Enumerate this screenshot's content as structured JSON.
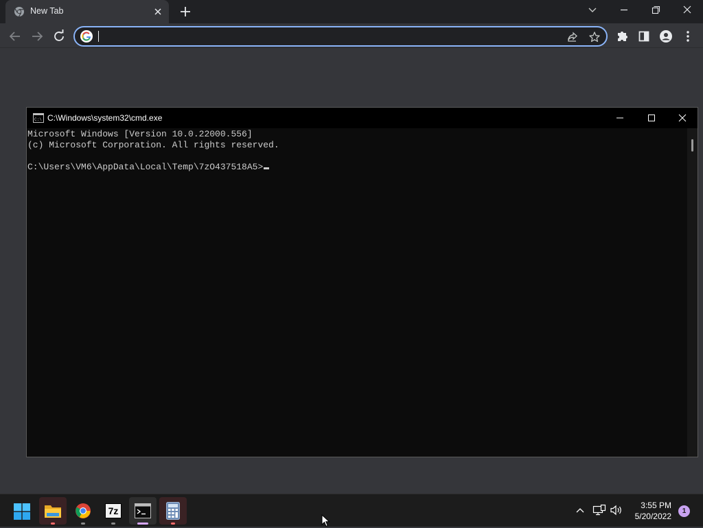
{
  "browser": {
    "tab": {
      "title": "New Tab"
    },
    "omnibox": {
      "value": "",
      "placeholder": ""
    }
  },
  "cmd": {
    "title": "C:\\Windows\\system32\\cmd.exe",
    "lines": [
      "Microsoft Windows [Version 10.0.22000.556]",
      "(c) Microsoft Corporation. All rights reserved.",
      "",
      "C:\\Users\\VM6\\AppData\\Local\\Temp\\7zO437518A5>"
    ]
  },
  "taskbar": {
    "apps": [
      {
        "icon": "windows-start-icon"
      },
      {
        "icon": "file-explorer-icon"
      },
      {
        "icon": "chrome-icon"
      },
      {
        "icon": "7zip-icon",
        "label": "7z"
      },
      {
        "icon": "cmd-icon"
      },
      {
        "icon": "calculator-icon"
      }
    ],
    "clock": {
      "time": "3:55 PM",
      "date": "5/20/2022"
    },
    "notifications": "1"
  },
  "colors": {
    "chrome_bg": "#35363a",
    "tabstrip_bg": "#202124",
    "omnibox_focus": "#8ab4f8",
    "cmd_bg": "#0c0c0c",
    "cmd_text": "#cccccc",
    "taskbar_bg": "#1c1c1c",
    "notif_badge": "#c8a2f0"
  }
}
